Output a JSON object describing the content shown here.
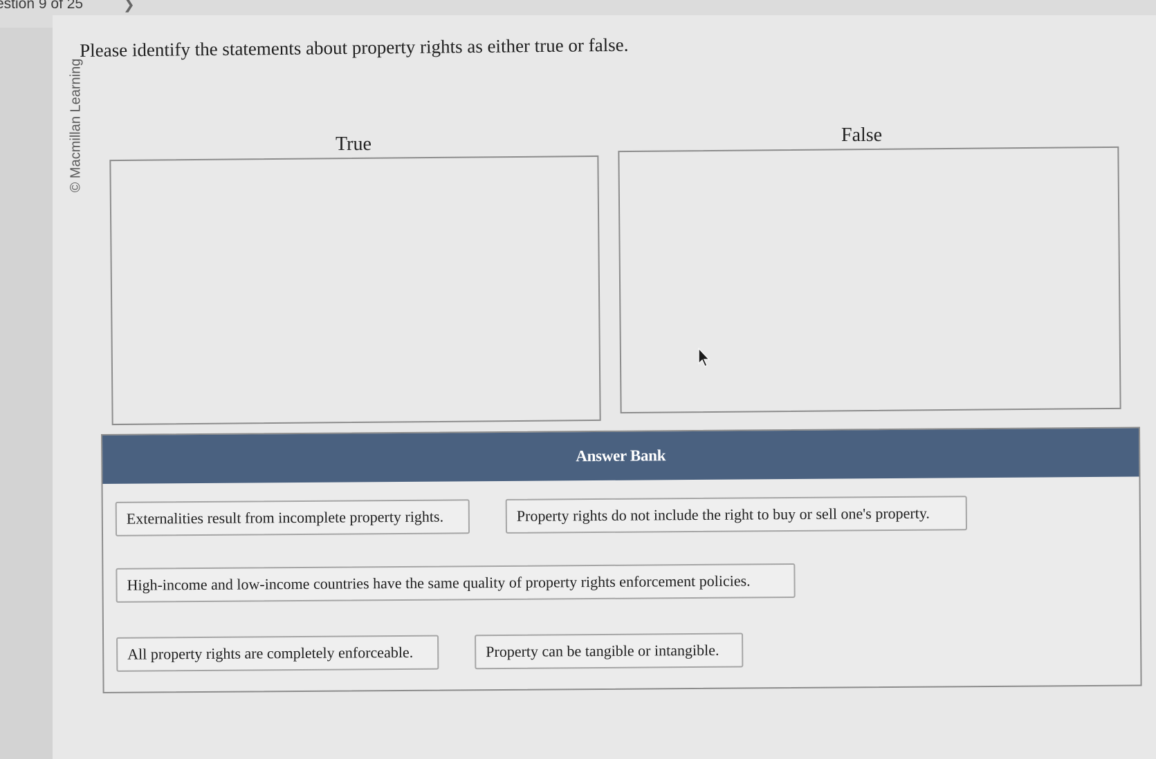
{
  "header": {
    "question_counter": "estion 9 of 25",
    "next_icon": "chevron-right-icon"
  },
  "sidebar": {
    "copyright": "© Macmillan Learning"
  },
  "question": {
    "prompt": "Please identify the statements about property rights as either true or false."
  },
  "targets": {
    "true_label": "True",
    "false_label": "False"
  },
  "answer_bank": {
    "title": "Answer Bank",
    "header_color": "#4a6180",
    "items": [
      "Externalities result from incomplete property rights.",
      "Property rights do not include the right to buy or sell one's property.",
      "High-income and low-income countries have the same quality of property rights enforcement policies.",
      "All property rights are completely enforceable.",
      "Property can be tangible or intangible."
    ]
  }
}
